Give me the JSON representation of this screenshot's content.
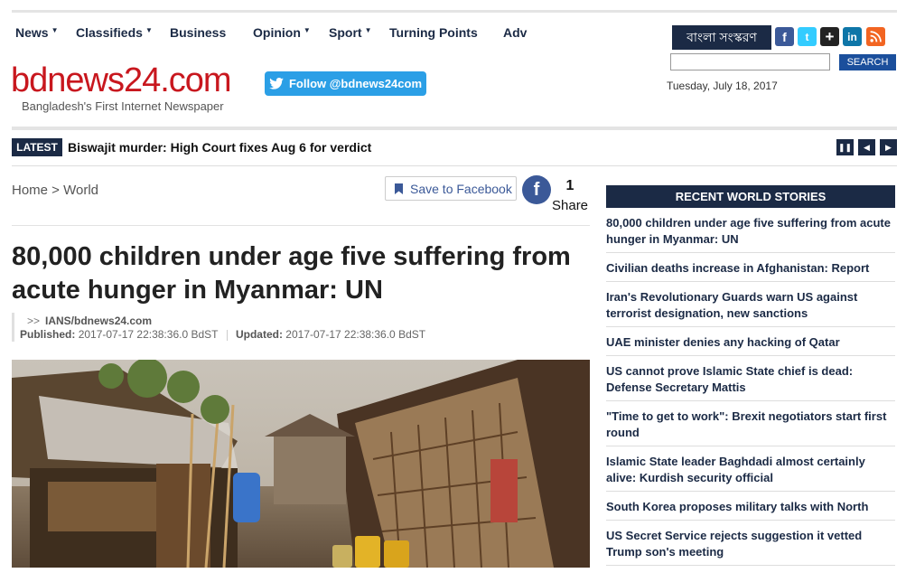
{
  "nav": [
    {
      "label": "News",
      "caret": "▼"
    },
    {
      "label": "Classifieds",
      "caret": "▼"
    },
    {
      "label": "Business",
      "caret": ""
    },
    {
      "label": "Opinion",
      "caret": "▼"
    },
    {
      "label": "Sport",
      "caret": "▼"
    },
    {
      "label": "Turning Points",
      "caret": ""
    },
    {
      "label": "Adv",
      "caret": ""
    }
  ],
  "logo": {
    "name": "bdnews24.com",
    "tagline": "Bangladesh's First Internet Newspaper"
  },
  "twitter": {
    "label": "Follow @bdnews24com"
  },
  "bangla_label": "বাংলা সংস্করণ",
  "search": {
    "button": "SEARCH",
    "value": ""
  },
  "date": "Tuesday, July 18, 2017",
  "ticker": {
    "badge": "LATEST",
    "text": "Biswajit murder: High Court fixes Aug 6 for verdict"
  },
  "breadcrumb": "Home > World",
  "facebook": {
    "save_label": "Save to Facebook",
    "share_count": "1",
    "share_label": "Share"
  },
  "article": {
    "headline": "80,000 children under age five suffering from acute hunger in Myanmar: UN",
    "source": "IANS/bdnews24.com",
    "published_label": "Published:",
    "published": "2017-07-17 22:38:36.0 BdST",
    "updated_label": "Updated:",
    "updated": "2017-07-17 22:38:36.0 BdST"
  },
  "recent": {
    "title": "RECENT WORLD STORIES",
    "items": [
      "80,000 children under age five suffering from acute hunger in Myanmar: UN",
      "Civilian deaths increase in Afghanistan: Report",
      "Iran's Revolutionary Guards warn US against terrorist designation, new sanctions",
      "UAE minister denies any hacking of Qatar",
      "US cannot prove Islamic State chief is dead: Defense Secretary Mattis",
      "\"Time to get to work\": Brexit negotiators start first round",
      "Islamic State leader Baghdadi almost certainly alive: Kurdish security official",
      "South Korea proposes military talks with North",
      "US Secret Service rejects suggestion it vetted Trump son's meeting"
    ]
  },
  "colors": {
    "navy": "#1b2a45",
    "brand_red": "#c8171e",
    "twitter_blue": "#2b9fe6",
    "facebook_blue": "#3b5998"
  }
}
